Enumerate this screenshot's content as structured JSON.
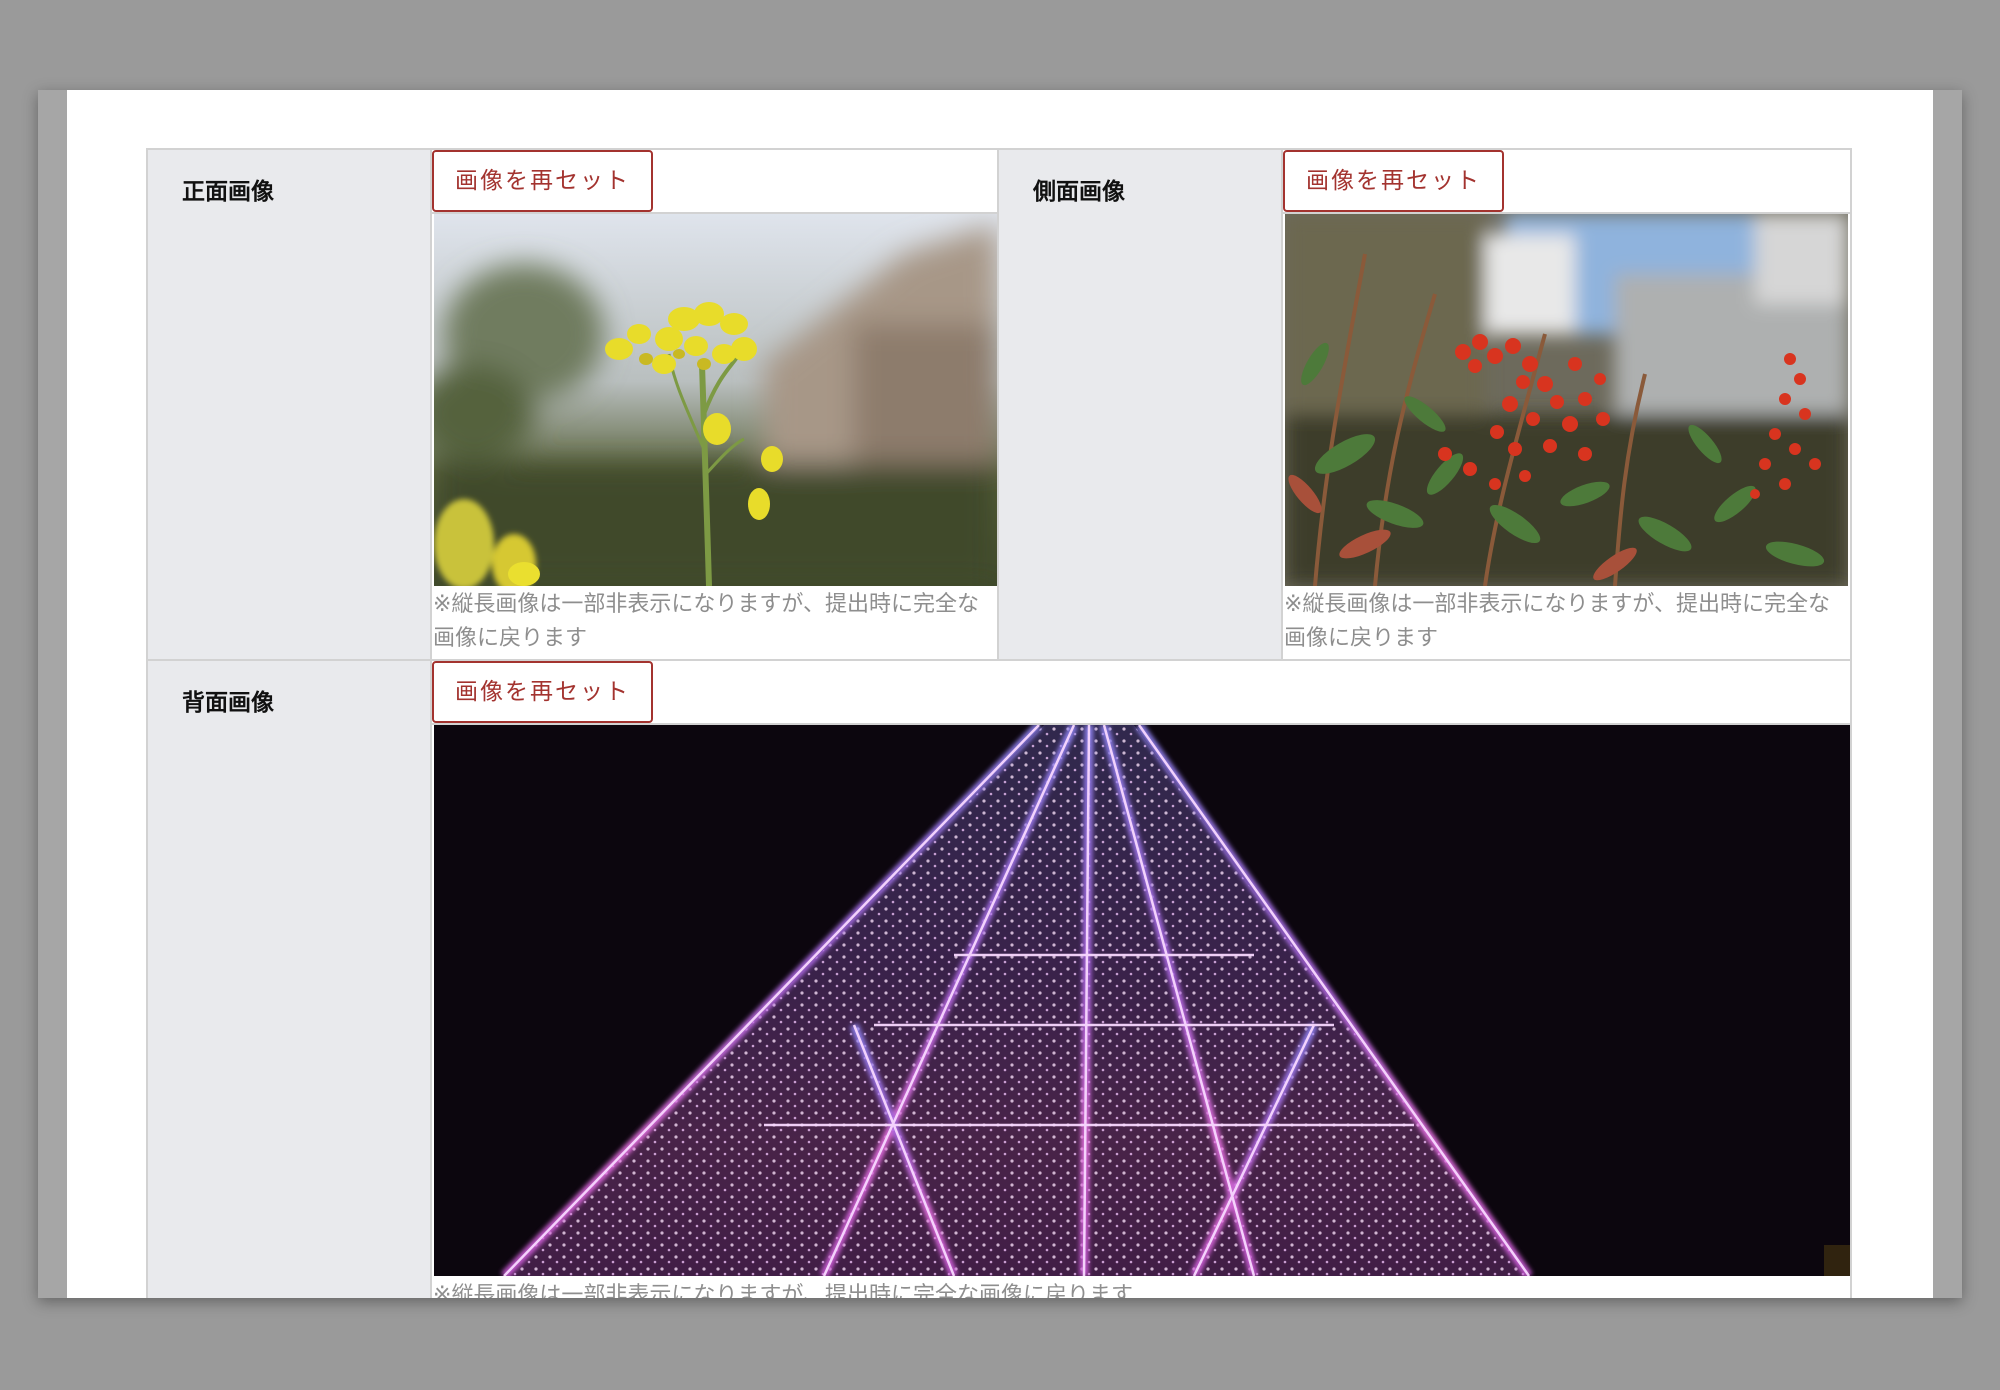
{
  "form": {
    "reset_label": "画像を再セット",
    "note_text": "※縦長画像は一部非表示になりますが、提出時に完全な画像に戻ります",
    "front": {
      "label": "正面画像"
    },
    "side": {
      "label": "側面画像"
    },
    "back": {
      "label": "背面画像"
    }
  },
  "colors": {
    "accent": "#a3332f",
    "label_bg": "#e9eaed",
    "border": "#d2d2d2",
    "note": "#8e8e8e",
    "backdrop": "#9a9a9a"
  }
}
